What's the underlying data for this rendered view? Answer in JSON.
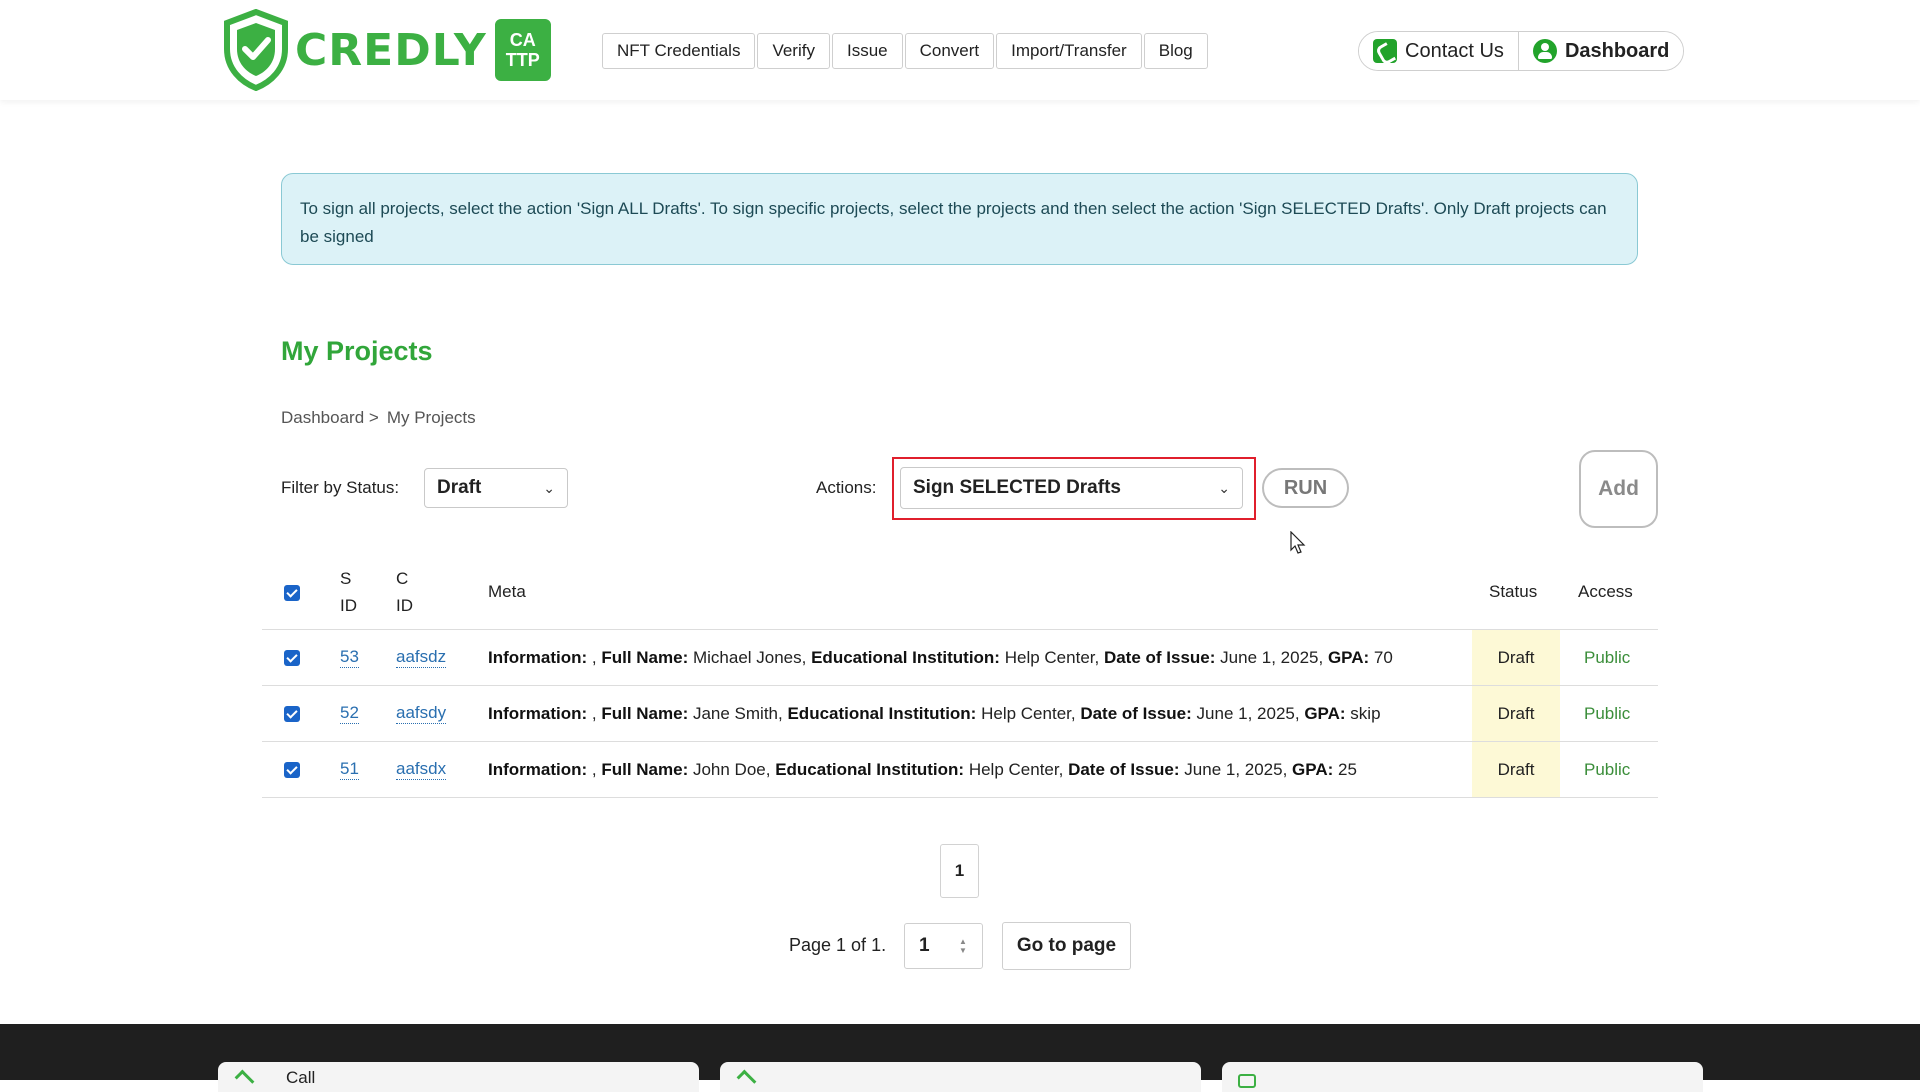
{
  "brand": {
    "name": "CREDLY",
    "badge_line1": "CA",
    "badge_line2": "TTP"
  },
  "nav": [
    {
      "label": "NFT Credentials"
    },
    {
      "label": "Verify"
    },
    {
      "label": "Issue"
    },
    {
      "label": "Convert"
    },
    {
      "label": "Import/Transfer"
    },
    {
      "label": "Blog"
    }
  ],
  "header_buttons": {
    "contact": "Contact Us",
    "dashboard": "Dashboard"
  },
  "alert": {
    "text": "To sign all projects, select the action 'Sign ALL Drafts'. To sign specific projects, select the projects and then select the action 'Sign SELECTED Drafts'. Only Draft projects can be signed"
  },
  "page_title": "My Projects",
  "breadcrumb": {
    "parent": "Dashboard >",
    "current": "My Projects"
  },
  "filter": {
    "label": "Filter by Status:",
    "value": "Draft"
  },
  "actions": {
    "label": "Actions:",
    "value": "Sign SELECTED Drafts",
    "run": "RUN",
    "add": "Add"
  },
  "table": {
    "headers": {
      "sid_1": "S",
      "sid_2": "ID",
      "cid_1": "C",
      "cid_2": "ID",
      "meta": "Meta",
      "status": "Status",
      "access": "Access"
    },
    "meta_labels": {
      "info": "Information:",
      "name": "Full Name:",
      "inst": "Educational Institution:",
      "date": "Date of Issue:",
      "gpa": "GPA:"
    },
    "rows": [
      {
        "sid": "53",
        "cid": "aafsdz",
        "name": "Michael Jones",
        "institution": "Help Center",
        "date": "June 1, 2025",
        "gpa": "70",
        "status": "Draft",
        "access": "Public"
      },
      {
        "sid": "52",
        "cid": "aafsdy",
        "name": "Jane Smith",
        "institution": "Help Center",
        "date": "June 1, 2025",
        "gpa": "skip",
        "status": "Draft",
        "access": "Public"
      },
      {
        "sid": "51",
        "cid": "aafsdx",
        "name": "John Doe",
        "institution": "Help Center",
        "date": "June 1, 2025",
        "gpa": "25",
        "status": "Draft",
        "access": "Public"
      }
    ]
  },
  "pagination": {
    "current_page": "1",
    "info": "Page 1 of 1.",
    "input_value": "1",
    "goto": "Go to page"
  },
  "footer": {
    "card1": "Call"
  },
  "colors": {
    "brand_green": "#3cb043",
    "alert_bg": "#dcf2f7",
    "highlight_red": "#e01f2c",
    "link_blue": "#2a6fb0",
    "status_bg": "#fdf9d6"
  }
}
